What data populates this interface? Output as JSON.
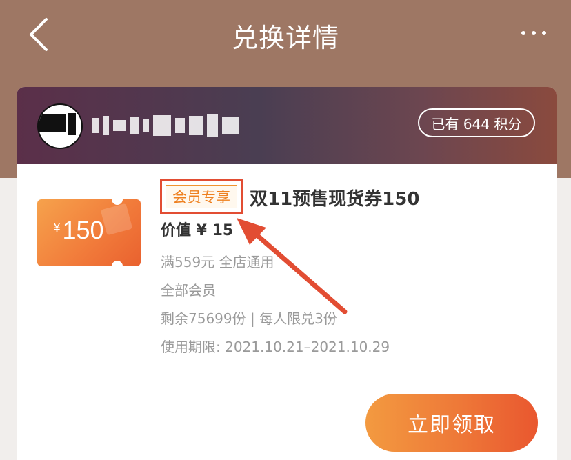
{
  "nav": {
    "title": "兑换详情"
  },
  "header": {
    "points_label": "已有 644 积分"
  },
  "coupon": {
    "currency": "¥",
    "amount": "150",
    "tag": "会员专享",
    "title": "双11预售现货券150",
    "value_line": "价值 ¥ 15",
    "condition": "满559元 全店通用",
    "audience": "全部会员",
    "stock": "剩余75699份 | 每人限兑3份",
    "validity": "使用期限: 2021.10.21–2021.10.29"
  },
  "actions": {
    "claim_label": "立即领取"
  },
  "icons": {
    "back": "chevron-left-icon",
    "more": "more-dots-icon"
  },
  "colors": {
    "header_bg": "#9e7764",
    "accent_orange": "#ee7838",
    "annotation_red": "#e24d33"
  }
}
